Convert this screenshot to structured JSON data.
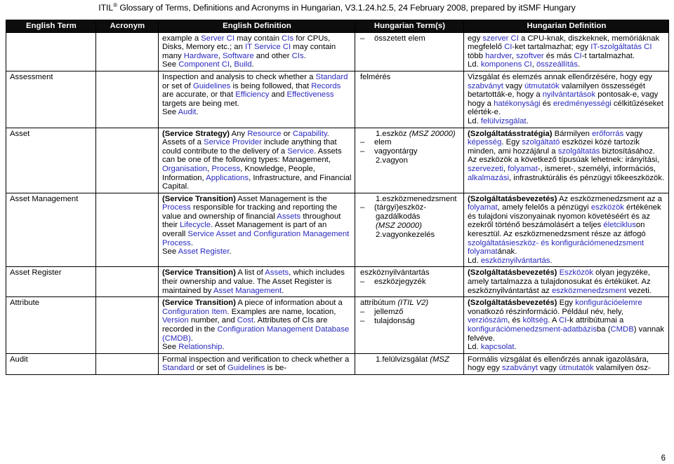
{
  "header": {
    "prefix": "ITIL",
    "superscript": "®",
    "rest": " Glossary of Terms, Definitions and Acronyms in Hungarian, V3.1.24.h2.5, 24 February 2008, prepared by itSMF Hungary"
  },
  "table": {
    "columns": [
      "English Term",
      "Acronym",
      "English Definition",
      "Hungarian Term(s)",
      "Hungarian Definition"
    ],
    "rows": [
      {
        "term": "",
        "acronym": "",
        "english_definition_runs": [
          {
            "t": "example a ",
            "s": "plain"
          },
          {
            "t": "Server CI",
            "s": "link"
          },
          {
            "t": " may contain ",
            "s": "plain"
          },
          {
            "t": "CIs",
            "s": "link"
          },
          {
            "t": " for CPUs, Disks, Memory etc.; an ",
            "s": "plain"
          },
          {
            "t": "IT Service CI",
            "s": "link"
          },
          {
            "t": " may contain many ",
            "s": "plain"
          },
          {
            "t": "Hardware",
            "s": "link"
          },
          {
            "t": ", ",
            "s": "plain"
          },
          {
            "t": "Software",
            "s": "link"
          },
          {
            "t": " and other ",
            "s": "plain"
          },
          {
            "t": "CIs",
            "s": "link"
          },
          {
            "t": ".",
            "s": "plain"
          },
          {
            "t": "\n",
            "s": "br"
          },
          {
            "t": "See ",
            "s": "plain"
          },
          {
            "t": "Component CI",
            "s": "link"
          },
          {
            "t": ", ",
            "s": "plain"
          },
          {
            "t": "Build",
            "s": "link"
          },
          {
            "t": ".",
            "s": "plain"
          }
        ],
        "hungarian_terms": [
          {
            "marker": "dash",
            "text": "összetett elem",
            "style": "plain"
          }
        ],
        "hungarian_definition_runs": [
          {
            "t": "egy ",
            "s": "plain"
          },
          {
            "t": "szerver CI",
            "s": "link"
          },
          {
            "t": " a CPU-knak, diszkeknek, memóriáknak megfelelő ",
            "s": "plain"
          },
          {
            "t": "CI",
            "s": "link"
          },
          {
            "t": "-ket tartalmazhat; egy ",
            "s": "plain"
          },
          {
            "t": "IT-szolgáltatás CI",
            "s": "link"
          },
          {
            "t": " több ",
            "s": "plain"
          },
          {
            "t": "hardver",
            "s": "link"
          },
          {
            "t": ", ",
            "s": "plain"
          },
          {
            "t": "szoftver",
            "s": "link"
          },
          {
            "t": " és más ",
            "s": "plain"
          },
          {
            "t": "CI",
            "s": "link"
          },
          {
            "t": "-t tartalmazhat.",
            "s": "plain"
          },
          {
            "t": "\n",
            "s": "br"
          },
          {
            "t": "Ld. ",
            "s": "plain"
          },
          {
            "t": "komponens CI",
            "s": "link"
          },
          {
            "t": ", ",
            "s": "plain"
          },
          {
            "t": "összeállítás",
            "s": "link"
          },
          {
            "t": ".",
            "s": "plain"
          }
        ]
      },
      {
        "term": "Assessment",
        "acronym": "",
        "english_definition_runs": [
          {
            "t": "Inspection and analysis to check whether a ",
            "s": "plain"
          },
          {
            "t": "Standard",
            "s": "link"
          },
          {
            "t": " or set of ",
            "s": "plain"
          },
          {
            "t": "Guidelines",
            "s": "link"
          },
          {
            "t": " is being followed, that ",
            "s": "plain"
          },
          {
            "t": "Records",
            "s": "link"
          },
          {
            "t": " are accurate, or that ",
            "s": "plain"
          },
          {
            "t": "Efficiency",
            "s": "link"
          },
          {
            "t": " and ",
            "s": "plain"
          },
          {
            "t": "Effectiveness",
            "s": "link"
          },
          {
            "t": " targets are being met.",
            "s": "plain"
          },
          {
            "t": "\n",
            "s": "br"
          },
          {
            "t": "See ",
            "s": "plain"
          },
          {
            "t": "Audit",
            "s": "link"
          },
          {
            "t": ".",
            "s": "plain"
          }
        ],
        "hungarian_terms": [
          {
            "marker": "none",
            "text": "felmérés",
            "style": "plain"
          }
        ],
        "hungarian_definition_runs": [
          {
            "t": "Vizsgálat és elemzés annak ellenőrzésére, hogy egy ",
            "s": "plain"
          },
          {
            "t": "szabványt",
            "s": "link"
          },
          {
            "t": " vagy ",
            "s": "plain"
          },
          {
            "t": "útmutatók",
            "s": "link"
          },
          {
            "t": " valamilyen összességét betartották-e, hogy a ",
            "s": "plain"
          },
          {
            "t": "nyilvántartások",
            "s": "link"
          },
          {
            "t": " pontosak-e, vagy hogy a ",
            "s": "plain"
          },
          {
            "t": "hatékonysági",
            "s": "link"
          },
          {
            "t": " és ",
            "s": "plain"
          },
          {
            "t": "eredményességi",
            "s": "link"
          },
          {
            "t": " célkitűzéseket elérték-e.",
            "s": "plain"
          },
          {
            "t": "\n",
            "s": "br"
          },
          {
            "t": "Ld. ",
            "s": "plain"
          },
          {
            "t": "felülvizsgálat",
            "s": "link"
          },
          {
            "t": ".",
            "s": "plain"
          }
        ]
      },
      {
        "term": "Asset",
        "acronym": "",
        "english_definition_runs": [
          {
            "t": "(Service Strategy)",
            "s": "bold"
          },
          {
            "t": " Any ",
            "s": "plain"
          },
          {
            "t": "Resource",
            "s": "link"
          },
          {
            "t": " or ",
            "s": "plain"
          },
          {
            "t": "Capability",
            "s": "link"
          },
          {
            "t": ". Assets of a ",
            "s": "plain"
          },
          {
            "t": "Service Provider",
            "s": "link"
          },
          {
            "t": " include anything that could contribute to the delivery of a ",
            "s": "plain"
          },
          {
            "t": "Service",
            "s": "link"
          },
          {
            "t": ". Assets can be one of the following types: Management, ",
            "s": "plain"
          },
          {
            "t": "Organisation",
            "s": "link"
          },
          {
            "t": ", ",
            "s": "plain"
          },
          {
            "t": "Process",
            "s": "link"
          },
          {
            "t": ", Knowledge, People, Information, ",
            "s": "plain"
          },
          {
            "t": "Applications",
            "s": "link"
          },
          {
            "t": ", Infrastructure, and Financial Capital.",
            "s": "plain"
          }
        ],
        "hungarian_terms": [
          {
            "marker": "1.",
            "text": "eszköz ",
            "style": "plain",
            "ital": "(MSZ 20000)"
          },
          {
            "marker": "dash",
            "text": "elem",
            "style": "plain"
          },
          {
            "marker": "dash",
            "text": "vagyontárgy",
            "style": "plain"
          },
          {
            "marker": "2.",
            "text": "vagyon",
            "style": "plain"
          }
        ],
        "hungarian_definition_runs": [
          {
            "t": "(Szolgáltatásstratégia)",
            "s": "bold"
          },
          {
            "t": " Bármilyen ",
            "s": "plain"
          },
          {
            "t": "erőforrás",
            "s": "link"
          },
          {
            "t": " vagy ",
            "s": "plain"
          },
          {
            "t": "képesség",
            "s": "link"
          },
          {
            "t": ". Egy ",
            "s": "plain"
          },
          {
            "t": "szolgáltató",
            "s": "link"
          },
          {
            "t": " eszközei közé tartozik minden, ami hozzájárul a ",
            "s": "plain"
          },
          {
            "t": "szolgáltatás",
            "s": "link"
          },
          {
            "t": " biztosításához. Az eszközök a következő típusúak lehetnek: irányítási, ",
            "s": "plain"
          },
          {
            "t": "szervezeti",
            "s": "link"
          },
          {
            "t": ", ",
            "s": "plain"
          },
          {
            "t": "folyamat",
            "s": "link"
          },
          {
            "t": "-, ismeret-, személyi, információs, ",
            "s": "plain"
          },
          {
            "t": "alkalmazási",
            "s": "link"
          },
          {
            "t": ", infrastruktúrális és pénzügyi tőkeeszközök.",
            "s": "plain"
          }
        ]
      },
      {
        "term": "Asset Management",
        "acronym": "",
        "english_definition_runs": [
          {
            "t": "(Service Transition)",
            "s": "bold"
          },
          {
            "t": " Asset Management is the ",
            "s": "plain"
          },
          {
            "t": "Process",
            "s": "link"
          },
          {
            "t": " responsible for tracking and reporting the value and ownership of financial ",
            "s": "plain"
          },
          {
            "t": "Assets",
            "s": "link"
          },
          {
            "t": " throughout their ",
            "s": "plain"
          },
          {
            "t": "Lifecycle",
            "s": "link"
          },
          {
            "t": ". Asset Management is part of an overall ",
            "s": "plain"
          },
          {
            "t": "Service Asset and Configuration Management Process",
            "s": "link"
          },
          {
            "t": ".",
            "s": "plain"
          },
          {
            "t": "\n",
            "s": "br"
          },
          {
            "t": "See ",
            "s": "plain"
          },
          {
            "t": "Asset Register",
            "s": "link"
          },
          {
            "t": ".",
            "s": "plain"
          }
        ],
        "hungarian_terms": [
          {
            "marker": "1.",
            "text": "eszközmenedzsment",
            "style": "plain"
          },
          {
            "marker": "dash",
            "text": "(tárgyi)eszköz-",
            "style": "plain",
            "cont": "gazdálkodás",
            "cont_ital": "(MSZ 20000)"
          },
          {
            "marker": "2.",
            "text": "vagyonkezelés",
            "style": "plain"
          }
        ],
        "hungarian_definition_runs": [
          {
            "t": "(Szolgáltatásbevezetés)",
            "s": "bold"
          },
          {
            "t": " Az eszközmenedzsment az a ",
            "s": "plain"
          },
          {
            "t": "folyamat",
            "s": "link"
          },
          {
            "t": ", amely felelős a pénzügyi ",
            "s": "plain"
          },
          {
            "t": "eszközök",
            "s": "link"
          },
          {
            "t": " értékének és tulajdoni viszonyainak nyomon követéséért és az ezekről történő beszámolásért a teljes ",
            "s": "plain"
          },
          {
            "t": "életciklus",
            "s": "link"
          },
          {
            "t": "on keresztül. Az eszközmenedzsment része az átfogó ",
            "s": "plain"
          },
          {
            "t": "szolgáltatásieszköz- és konfigurációmenedzsment folyamat",
            "s": "link"
          },
          {
            "t": "ának.",
            "s": "plain"
          },
          {
            "t": "\n",
            "s": "br"
          },
          {
            "t": "Ld. ",
            "s": "plain"
          },
          {
            "t": "eszköznyilvántartás",
            "s": "link"
          },
          {
            "t": ".",
            "s": "plain"
          }
        ]
      },
      {
        "term": "Asset Register",
        "acronym": "",
        "english_definition_runs": [
          {
            "t": "(Service Transition)",
            "s": "bold"
          },
          {
            "t": " A list of ",
            "s": "plain"
          },
          {
            "t": "Assets",
            "s": "link"
          },
          {
            "t": ", which includes their ownership and value. The Asset Register is maintained by ",
            "s": "plain"
          },
          {
            "t": "Asset Management",
            "s": "link"
          },
          {
            "t": ".",
            "s": "plain"
          }
        ],
        "hungarian_terms": [
          {
            "marker": "none",
            "text": "eszköznyilvántartás",
            "style": "plain"
          },
          {
            "marker": "dash",
            "text": "eszközjegyzék",
            "style": "plain"
          }
        ],
        "hungarian_definition_runs": [
          {
            "t": "(Szolgáltatásbevezetés)",
            "s": "bold"
          },
          {
            "t": " ",
            "s": "plain"
          },
          {
            "t": "Eszközök",
            "s": "link"
          },
          {
            "t": " olyan jegyzéke, amely tartalmazza a tulajdonosukat és értéküket. Az eszköznyilvántartást az ",
            "s": "plain"
          },
          {
            "t": "eszközmenedzsment",
            "s": "link"
          },
          {
            "t": " vezeti.",
            "s": "plain"
          }
        ]
      },
      {
        "term": "Attribute",
        "acronym": "",
        "english_definition_runs": [
          {
            "t": "(Service Transition)",
            "s": "bold"
          },
          {
            "t": " A piece of information about a ",
            "s": "plain"
          },
          {
            "t": "Configuration Item",
            "s": "link"
          },
          {
            "t": ". Examples are name, location, ",
            "s": "plain"
          },
          {
            "t": "Version",
            "s": "link"
          },
          {
            "t": " number, and ",
            "s": "plain"
          },
          {
            "t": "Cost",
            "s": "link"
          },
          {
            "t": ". Attributes of CIs are recorded in the ",
            "s": "plain"
          },
          {
            "t": "Configuration Management Database (CMDB)",
            "s": "link"
          },
          {
            "t": ".",
            "s": "plain"
          },
          {
            "t": "\n",
            "s": "br"
          },
          {
            "t": "See ",
            "s": "plain"
          },
          {
            "t": "Relationship",
            "s": "link"
          },
          {
            "t": ".",
            "s": "plain"
          }
        ],
        "hungarian_terms": [
          {
            "marker": "none",
            "text": "attribútum ",
            "style": "plain",
            "ital": "(ITIL V2)"
          },
          {
            "marker": "dash",
            "text": "jellemző",
            "style": "plain"
          },
          {
            "marker": "dash",
            "text": "tulajdonság",
            "style": "plain"
          }
        ],
        "hungarian_definition_runs": [
          {
            "t": "(Szolgáltatásbevezetés)",
            "s": "bold"
          },
          {
            "t": " Egy ",
            "s": "plain"
          },
          {
            "t": "konfigurációelemre",
            "s": "link"
          },
          {
            "t": " vonatkozó részinformáció. Például név, hely, ",
            "s": "plain"
          },
          {
            "t": "verziószám",
            "s": "link"
          },
          {
            "t": ", és ",
            "s": "plain"
          },
          {
            "t": "költség",
            "s": "link"
          },
          {
            "t": ". A ",
            "s": "plain"
          },
          {
            "t": "CI",
            "s": "link"
          },
          {
            "t": "-k attribútumai a ",
            "s": "plain"
          },
          {
            "t": "konfigurációmenedzsment-adatbázis",
            "s": "link"
          },
          {
            "t": "ba (",
            "s": "plain"
          },
          {
            "t": "CMDB",
            "s": "link"
          },
          {
            "t": ") vannak felvéve.",
            "s": "plain"
          },
          {
            "t": "\n",
            "s": "br"
          },
          {
            "t": "Ld. ",
            "s": "plain"
          },
          {
            "t": "kapcsolat",
            "s": "link"
          },
          {
            "t": ".",
            "s": "plain"
          }
        ]
      },
      {
        "term": "Audit",
        "acronym": "",
        "english_definition_runs": [
          {
            "t": "Formal inspection and verification to check whether a ",
            "s": "plain"
          },
          {
            "t": "Standard",
            "s": "link"
          },
          {
            "t": " or set of ",
            "s": "plain"
          },
          {
            "t": "Guidelines",
            "s": "link"
          },
          {
            "t": " is be-",
            "s": "plain"
          }
        ],
        "hungarian_terms": [
          {
            "marker": "1.",
            "text": "felülvizsgálat ",
            "style": "plain",
            "ital": "(MSZ"
          }
        ],
        "hungarian_definition_runs": [
          {
            "t": "Formális vizsgálat és ellenőrzés annak igazolására, hogy egy ",
            "s": "plain"
          },
          {
            "t": "szabványt",
            "s": "link"
          },
          {
            "t": " vagy ",
            "s": "plain"
          },
          {
            "t": "útmutatók",
            "s": "link"
          },
          {
            "t": " valamilyen ösz-",
            "s": "plain"
          }
        ]
      }
    ]
  },
  "footer": {
    "page_number": "6"
  },
  "colors": {
    "link": "#2a2ac0",
    "header_bg": "#0d0d0d",
    "header_fg": "#ffffff",
    "border": "#000000"
  }
}
